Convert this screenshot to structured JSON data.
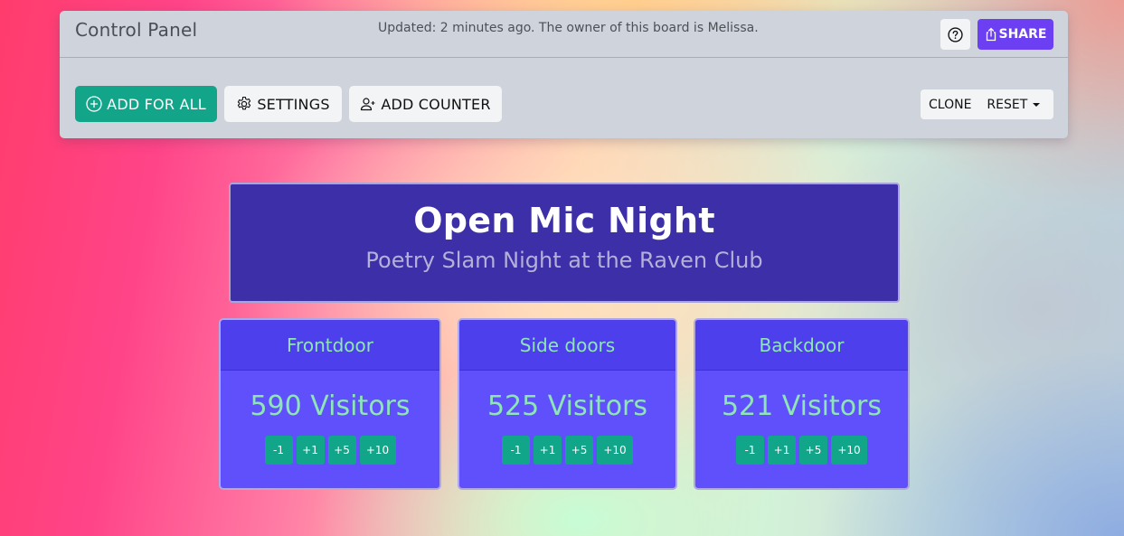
{
  "control_panel": {
    "title": "Control Panel",
    "status": "Updated: 2 minutes ago. The owner of this board is Melissa.",
    "help_icon": "question-circle-icon",
    "share": {
      "label": "SHARE",
      "icon": "share-icon"
    },
    "actions": {
      "add_for_all": {
        "label": "ADD FOR ALL",
        "icon": "plus-circle-icon"
      },
      "settings": {
        "label": "SETTINGS",
        "icon": "gear-icon"
      },
      "add_counter": {
        "label": "ADD COUNTER",
        "icon": "person-add-icon"
      },
      "clone": {
        "label": "CLONE"
      },
      "reset": {
        "label": "RESET",
        "icon": "caret-down-icon"
      }
    }
  },
  "board": {
    "title": "Open Mic Night",
    "subtitle": "Poetry Slam Night at the Raven Club"
  },
  "counters": [
    {
      "name": "Frontdoor",
      "value_text": "590 Visitors",
      "buttons": [
        "-1",
        "+1",
        "+5",
        "+10"
      ]
    },
    {
      "name": "Side doors",
      "value_text": "525 Visitors",
      "buttons": [
        "-1",
        "+1",
        "+5",
        "+10"
      ]
    },
    {
      "name": "Backdoor",
      "value_text": "521 Visitors",
      "buttons": [
        "-1",
        "+1",
        "+5",
        "+10"
      ]
    }
  ],
  "colors": {
    "primary_green": "#13a58a",
    "share_purple": "#6d3ff3",
    "board_bg": "#3c2fa8",
    "counter_bg": "#6050fc",
    "counter_header_bg": "#4e3fec",
    "counter_text": "#8ee6b6"
  }
}
